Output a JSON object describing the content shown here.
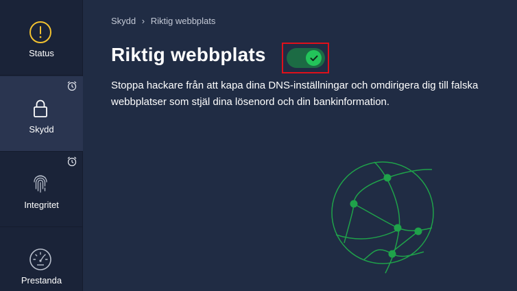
{
  "sidebar": {
    "items": [
      {
        "label": "Status",
        "icon": "alert-circle-icon",
        "active": false
      },
      {
        "label": "Skydd",
        "icon": "lock-icon",
        "active": true,
        "alarm": true
      },
      {
        "label": "Integritet",
        "icon": "fingerprint-icon",
        "active": false,
        "alarm": true
      },
      {
        "label": "Prestanda",
        "icon": "speedometer-icon",
        "active": false
      }
    ]
  },
  "breadcrumb": {
    "parent": "Skydd",
    "separator": "›",
    "current": "Riktig webbplats"
  },
  "main": {
    "title": "Riktig webbplats",
    "toggle_on": true,
    "description": "Stoppa hackare från att kapa dina DNS-inställningar och omdirigera dig till falska webbplatser som stjäl dina lösenord och din bankinformation."
  },
  "colors": {
    "background": "#202c44",
    "sidebar": "#1a2338",
    "sidebar_active": "#2a3550",
    "accent_green": "#23c45a",
    "status_yellow": "#f2c230",
    "highlight_red": "#e0101a"
  }
}
